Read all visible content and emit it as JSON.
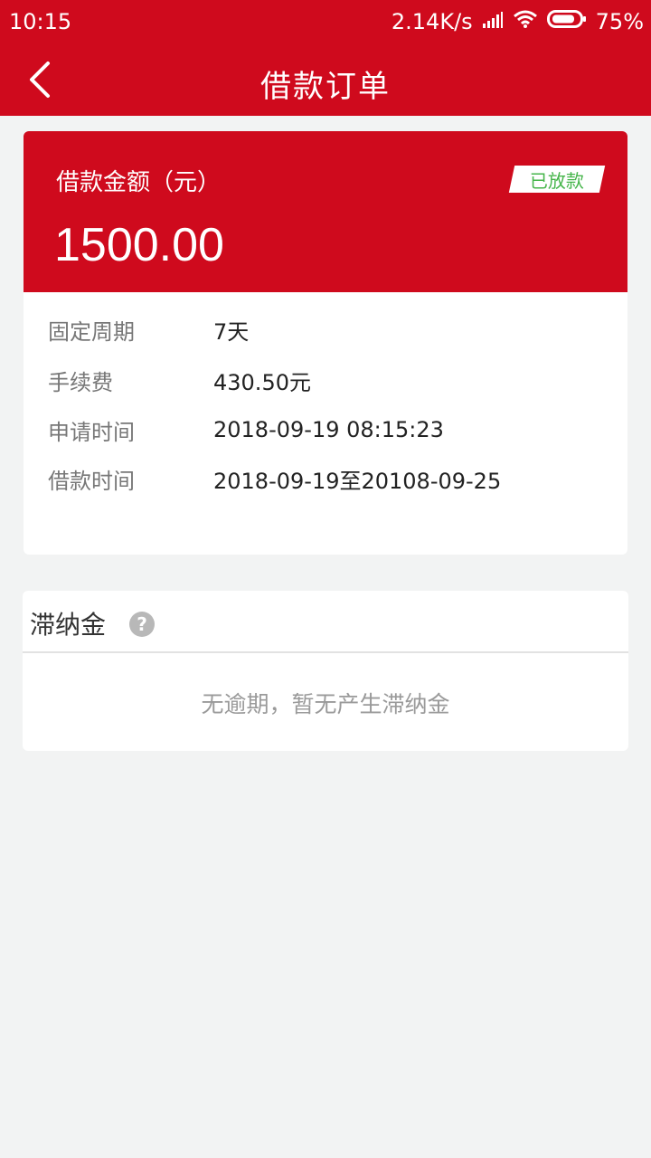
{
  "status_bar": {
    "time": "10:15",
    "network_speed": "2.14K/s",
    "battery": "75%",
    "icons": [
      "signal-icon",
      "wifi-icon",
      "battery-icon"
    ]
  },
  "nav": {
    "back_icon": "chevron-left-icon",
    "title": "借款订单"
  },
  "loan_card": {
    "amount_label": "借款金额（元）",
    "amount": "1500.00",
    "status": "已放款",
    "details": [
      {
        "label": "固定周期",
        "value": "7天"
      },
      {
        "label": "手续费",
        "value": "430.50元"
      },
      {
        "label": "申请时间",
        "value": "2018-09-19 08:15:23"
      },
      {
        "label": "借款时间",
        "value": "2018-09-19至20108-09-25"
      }
    ]
  },
  "late_fee": {
    "title": "滞纳金",
    "help_icon": "question-mark-icon",
    "help_glyph": "?",
    "empty_text": "无逾期，暂无产生滞纳金"
  },
  "colors": {
    "brand_red": "#cf0a1d",
    "status_green": "#46b54a",
    "page_background": "#f2f3f3"
  }
}
